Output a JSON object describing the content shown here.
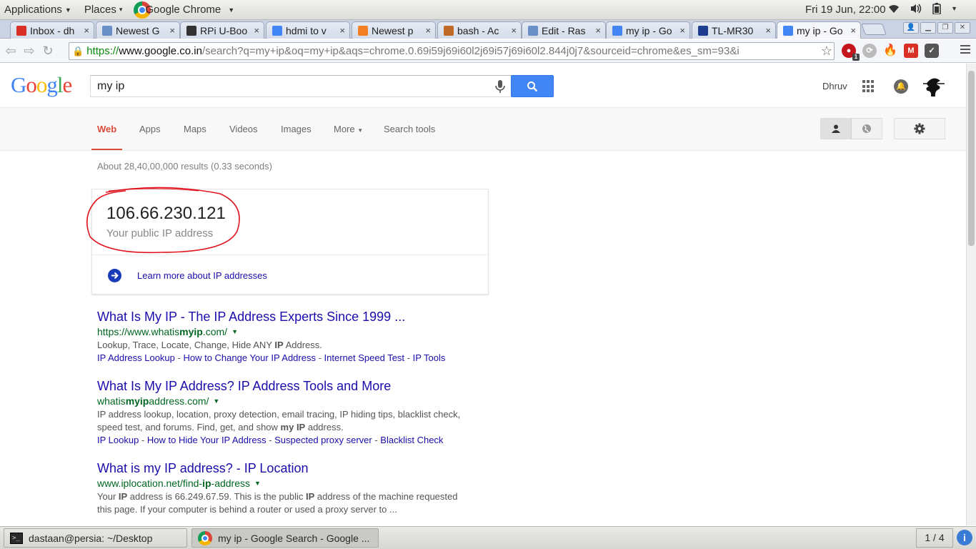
{
  "system_panel": {
    "applications_label": "Applications",
    "places_label": "Places",
    "active_app_label": "Google Chrome",
    "clock": "Fri 19 Jun, 22:00"
  },
  "browser": {
    "tabs": [
      {
        "title": "Inbox - dh",
        "favicon": "gmail-icon",
        "color": "#d93025"
      },
      {
        "title": "Newest G",
        "favicon": "rpi-icon",
        "color": "#6b8fc7"
      },
      {
        "title": "RPi U-Boo",
        "favicon": "tux-icon",
        "color": "#333333"
      },
      {
        "title": "hdmi to v",
        "favicon": "google-icon",
        "color": "#4285f4"
      },
      {
        "title": "Newest p",
        "favicon": "stackoverflow-icon",
        "color": "#f48024"
      },
      {
        "title": "bash - Ac",
        "favicon": "stackexchange-icon",
        "color": "#c06a2a"
      },
      {
        "title": "Edit - Ras",
        "favicon": "rpi-icon",
        "color": "#6b8fc7"
      },
      {
        "title": "my ip - Go",
        "favicon": "google-icon",
        "color": "#4285f4"
      },
      {
        "title": "TL-MR30",
        "favicon": "n-icon",
        "color": "#1e3d8f"
      },
      {
        "title": "my ip - Go",
        "favicon": "google-icon",
        "color": "#4285f4"
      }
    ],
    "url": {
      "scheme": "https://",
      "host": "www.google.co.in",
      "rest": "/search?q=my+ip&oq=my+ip&aqs=chrome.0.69i59j69i60l2j69i57j69i60l2.844j0j7&sourceid=chrome&es_sm=93&i"
    },
    "extension_badge": "1"
  },
  "google": {
    "logo": [
      "G",
      "o",
      "o",
      "g",
      "l",
      "e"
    ],
    "query": "my ip",
    "user_name": "Dhruv",
    "nav_tabs": [
      "Web",
      "Apps",
      "Maps",
      "Videos",
      "Images",
      "More",
      "Search tools"
    ],
    "result_stats": "About 28,40,00,000 results (0.33 seconds)",
    "ip_card": {
      "ip": "106.66.230.121",
      "caption": "Your public IP address",
      "learn_more": "Learn more about IP addresses"
    },
    "results": [
      {
        "title": "What Is My IP - The IP Address Experts Since 1999 ...",
        "url_pre": "https://www.whatis",
        "url_bold": "myip",
        "url_post": ".com/",
        "snippet_pre": "Lookup, Trace, Locate, Change, Hide ANY ",
        "snippet_bold": "IP",
        "snippet_post": " Address.",
        "snippet_line2": "",
        "links": [
          "IP Address Lookup",
          "How to Change Your IP Address",
          "Internet Speed Test",
          "IP Tools"
        ]
      },
      {
        "title": "What Is My IP Address? IP Address Tools and More",
        "url_pre": "whatis",
        "url_bold": "myip",
        "url_post": "address.com/",
        "snippet_pre": "IP address lookup, location, proxy detection, email tracing, IP hiding tips, blacklist check,",
        "snippet_line2_pre": "speed test, and forums. Find, get, and show ",
        "snippet_line2_bold": "my IP",
        "snippet_line2_post": " address.",
        "links": [
          "IP Lookup",
          "How to Hide Your IP Address",
          "Suspected proxy server",
          "Blacklist Check"
        ]
      },
      {
        "title": "What is my IP address? - IP Location",
        "url_pre": "www.iplocation.net/find-",
        "url_bold": "ip",
        "url_post": "-address",
        "snippet_pre": "Your ",
        "snippet_bold": "IP",
        "snippet_mid": " address is 66.249.67.59. This is the public ",
        "snippet_bold2": "IP",
        "snippet_post": " address of the machine requested",
        "snippet_line2": "this page. If your computer is behind a router or used a proxy server to ..."
      }
    ]
  },
  "taskbar": {
    "terminal_task": "dastaan@persia: ~/Desktop",
    "chrome_task": "my ip - Google Search - Google ...",
    "workspace": "1 / 4",
    "info_badge": "i"
  }
}
